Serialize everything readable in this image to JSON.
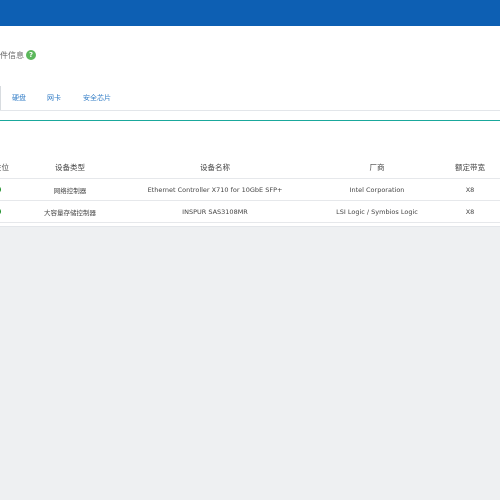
{
  "panel": {
    "info_title": "件信息"
  },
  "tabs": [
    {
      "label": "硬盘"
    },
    {
      "label": "网卡"
    },
    {
      "label": "安全芯片"
    }
  ],
  "table": {
    "headers": {
      "status": "在位",
      "type": "设备类型",
      "name": "设备名称",
      "vendor": "厂商",
      "width": "额定带宽"
    },
    "rows": [
      {
        "status": "present",
        "type": "网络控制器",
        "name": "Ethernet Controller X710 for 10GbE SFP+",
        "vendor": "Intel Corporation",
        "width": "X8"
      },
      {
        "status": "present",
        "type": "大容量存储控制器",
        "name": "INSPUR SAS3108MR",
        "vendor": "LSI Logic / Symbios Logic",
        "width": "X8"
      }
    ]
  },
  "colors": {
    "topbar": "#0d5fb3",
    "tab_text": "#2f7bc6",
    "accent_line": "#1aa89c",
    "status_ok": "#1d8f2a",
    "help_icon": "#5cb85c"
  },
  "icons": {
    "help": "question-circle-icon",
    "status": "status-dot-icon"
  }
}
